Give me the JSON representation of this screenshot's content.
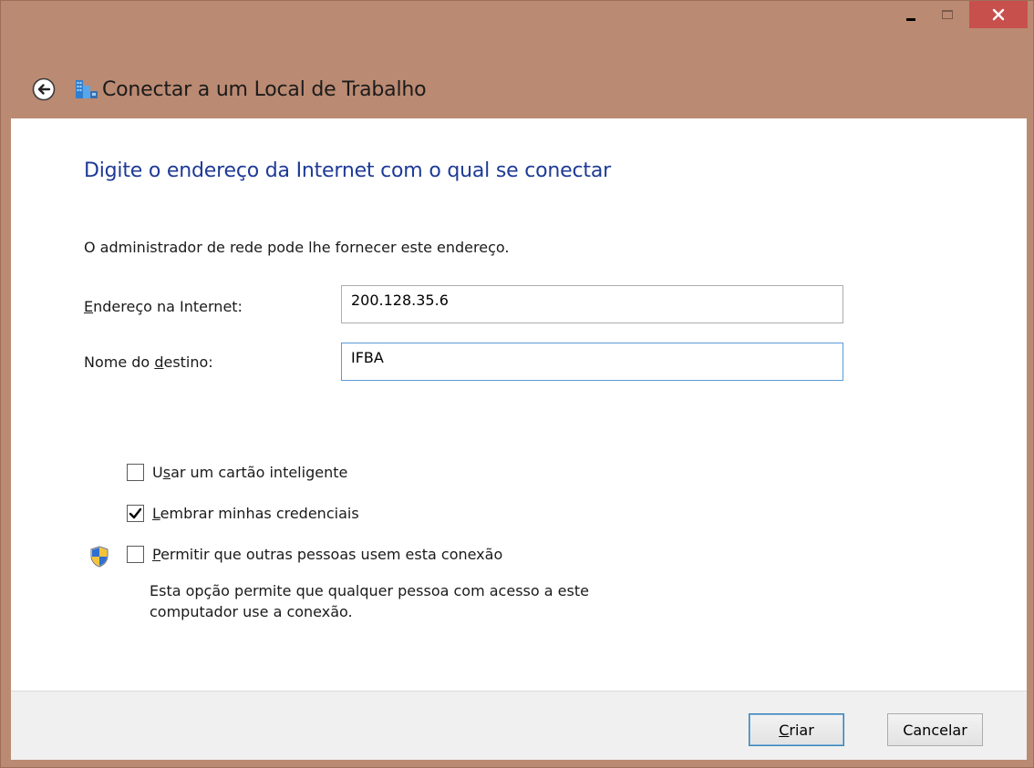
{
  "window": {
    "title": "Conectar a um Local de Trabalho",
    "caption": {
      "minimize_icon": "minimize-icon",
      "maximize_icon": "maximize-icon",
      "close_icon": "close-icon"
    }
  },
  "main": {
    "instruction": "Digite o endereço da Internet com o qual se conectar",
    "description": "O administrador de rede pode lhe fornecer este endereço.",
    "address": {
      "label_first": "E",
      "label_rest": "ndereço na Internet:",
      "value": "200.128.35.6"
    },
    "destination": {
      "label_before": "Nome do ",
      "label_underlined": "d",
      "label_after": "estino:",
      "value": "IFBA"
    },
    "options": {
      "smartcard": {
        "before": "U",
        "underlined": "s",
        "after": "ar um cartão inteligente",
        "checked": false
      },
      "remember": {
        "underlined": "L",
        "after": "embrar minhas credenciais",
        "checked": true
      },
      "allow_others": {
        "underlined": "P",
        "after": "ermitir que outras pessoas usem esta conexão",
        "checked": false,
        "help_line1": "Esta opção permite que qualquer pessoa com acesso a este",
        "help_line2": "computador use a conexão."
      }
    }
  },
  "footer": {
    "create": {
      "underlined": "C",
      "after": "riar"
    },
    "cancel": "Cancelar"
  },
  "colors": {
    "frame": "#bb8a72",
    "instruction": "#1e3a96",
    "close_button": "#c7504d"
  }
}
